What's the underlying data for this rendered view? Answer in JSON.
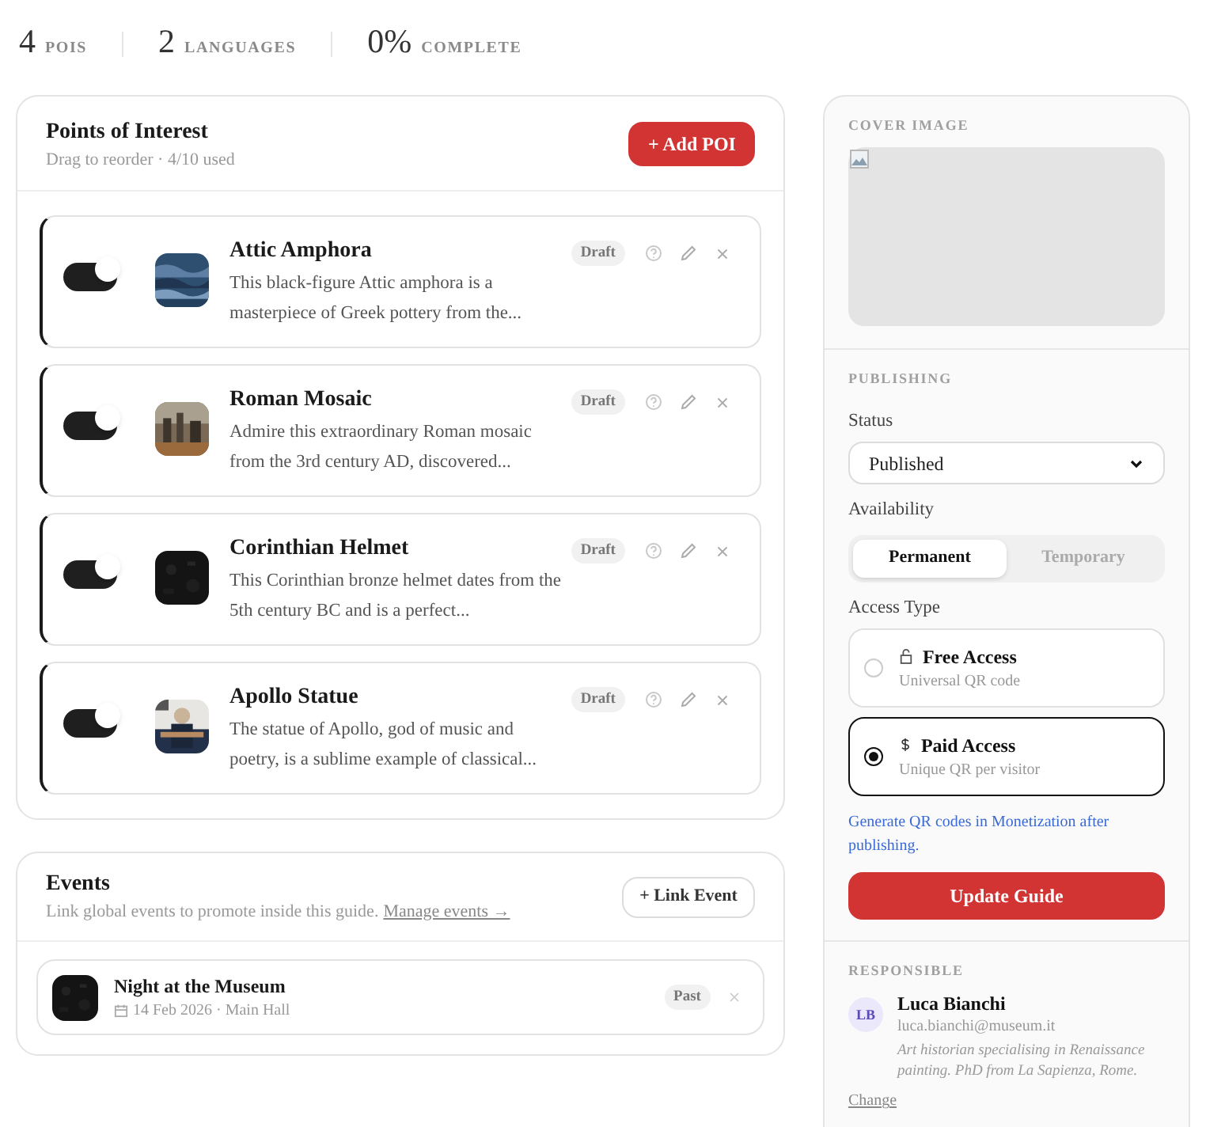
{
  "stats": [
    {
      "value": "4",
      "label": "POIS"
    },
    {
      "value": "2",
      "label": "LANGUAGES"
    },
    {
      "value": "0%",
      "label": "COMPLETE"
    }
  ],
  "poi_panel": {
    "title": "Points of Interest",
    "subtitle": "Drag to reorder · 4/10 used",
    "add_button": "+ Add POI"
  },
  "pois": [
    {
      "title": "Attic Amphora",
      "description": "This black-figure Attic amphora is a masterpiece of Greek pottery from the...",
      "enabled": true,
      "status": "Draft"
    },
    {
      "title": "Roman Mosaic",
      "description": "Admire this extraordinary Roman mosaic from the 3rd century AD, discovered...",
      "enabled": true,
      "status": "Draft"
    },
    {
      "title": "Corinthian Helmet",
      "description": "This Corinthian bronze helmet dates from the 5th century BC and is a perfect...",
      "enabled": true,
      "status": "Draft"
    },
    {
      "title": "Apollo Statue",
      "description": "The statue of Apollo, god of music and poetry, is a sublime example of classical...",
      "enabled": true,
      "status": "Draft"
    }
  ],
  "events": {
    "title": "Events",
    "subtitle": "Link global events to promote inside this guide.",
    "manage_link": "Manage events →",
    "link_button": "+ Link Event",
    "items": [
      {
        "title": "Night at the Museum",
        "meta": "14 Feb 2026 · Main Hall",
        "status": "Past"
      }
    ]
  },
  "sidebar": {
    "cover_image": {
      "label": "COVER IMAGE"
    },
    "publishing": {
      "label": "PUBLISHING",
      "status_label": "Status",
      "status_value": "Published",
      "availability_label": "Availability",
      "availability_options": [
        {
          "label": "Permanent",
          "selected": true
        },
        {
          "label": "Temporary",
          "selected": false
        }
      ],
      "access_label": "Access Type",
      "access_options": [
        {
          "kind": "free",
          "title": "Free Access",
          "subtitle": "Universal QR code",
          "selected": false
        },
        {
          "kind": "paid",
          "title": "Paid Access",
          "subtitle": "Unique QR per visitor",
          "selected": true
        }
      ],
      "note": "Generate QR codes in Monetization after publishing.",
      "update_button": "Update Guide"
    },
    "responsible": {
      "label": "RESPONSIBLE",
      "initials": "LB",
      "name": "Luca Bianchi",
      "email": "luca.bianchi@museum.it",
      "bio": "Art historian specialising in Renaissance painting. PhD from La Sapienza, Rome.",
      "change": "Change"
    }
  }
}
